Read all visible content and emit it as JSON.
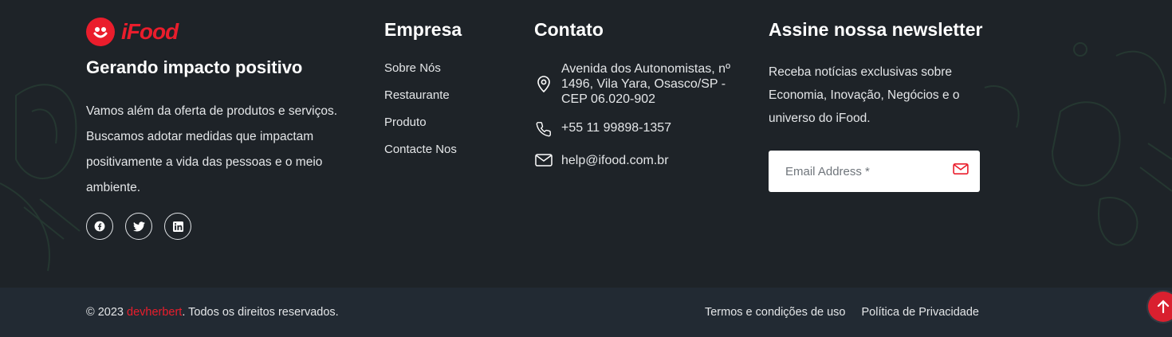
{
  "brand": {
    "logo_text": "iFood",
    "accent_color": "#ea1d2c"
  },
  "about": {
    "tagline": "Gerando impacto positivo",
    "description": "Vamos além da oferta de produtos e serviços. Buscamos adotar medidas que impactam positivamente a vida das pessoas e o meio ambiente.",
    "socials": [
      {
        "icon": "facebook-icon"
      },
      {
        "icon": "twitter-icon"
      },
      {
        "icon": "linkedin-icon"
      }
    ]
  },
  "company": {
    "title": "Empresa",
    "links": [
      "Sobre Nós",
      "Restaurante",
      "Produto",
      "Contacte Nos"
    ]
  },
  "contact": {
    "title": "Contato",
    "address_line1": "Avenida dos Autonomistas, nº",
    "address_line2": "1496, Vila Yara, Osasco/SP -",
    "address_line3": "CEP 06.020-902",
    "phone": "+55 11 99898-1357",
    "email": "help@ifood.com.br"
  },
  "newsletter": {
    "title": "Assine nossa newsletter",
    "line1": "Receba notícias exclusivas sobre",
    "line2": "Economia, Inovação, Negócios e o",
    "line3": "universo do iFood.",
    "email_placeholder": "Email Address *"
  },
  "bottom": {
    "copyright_prefix": "© 2023 ",
    "copyright_brand": "devherbert",
    "copyright_suffix": ". Todos os direitos reservados.",
    "terms": "Termos e condições de uso",
    "privacy": "Política de Privacidade"
  }
}
